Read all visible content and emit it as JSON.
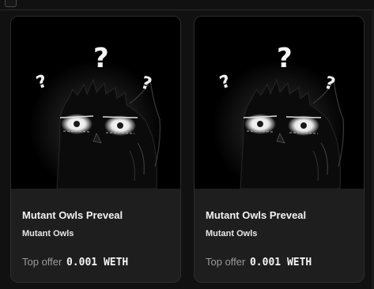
{
  "cards": [
    {
      "name": "Mutant Owls Preveal",
      "collection": "Mutant Owls",
      "offer_label": "Top offer",
      "offer_value": "0.001 WETH",
      "image": "owl-silhouette-with-question-marks"
    },
    {
      "name": "Mutant Owls Preveal",
      "collection": "Mutant Owls",
      "offer_label": "Top offer",
      "offer_value": "0.001 WETH",
      "image": "owl-silhouette-with-question-marks"
    }
  ],
  "colors": {
    "page_bg": "#111111",
    "card_bg": "#1e1e1e",
    "card_border": "#2d2d2d",
    "label_gray": "#9a9a9a",
    "text_white": "#f2f2f2"
  }
}
